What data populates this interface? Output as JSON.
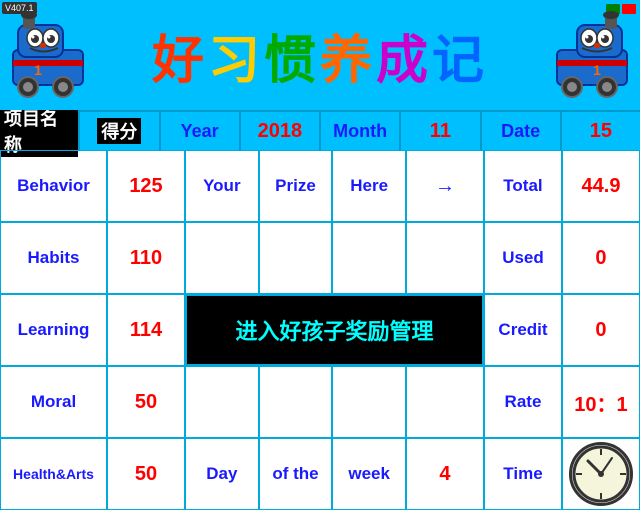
{
  "version": "V407.1",
  "flags": [
    "red",
    "green"
  ],
  "title": {
    "chars": [
      "好",
      "习",
      "惯",
      "养",
      "成",
      "记"
    ],
    "colors": [
      "#ff3300",
      "#ffcc00",
      "#009900",
      "#ff6600",
      "#cc00cc",
      "#0066ff"
    ]
  },
  "date_bar": {
    "year_label": "Year",
    "year_value": "2018",
    "month_label": "Month",
    "month_value": "11",
    "date_label": "Date",
    "date_value": "15"
  },
  "rows": [
    {
      "label": "Behavior",
      "score": "125",
      "col3": "Your",
      "col4": "Prize",
      "col5": "Here",
      "col6": "→",
      "right_label": "Total",
      "right_value": "44.9"
    },
    {
      "label": "Habits",
      "score": "110",
      "col3": "",
      "col4": "",
      "col5": "",
      "col6": "",
      "right_label": "Used",
      "right_value": "0"
    },
    {
      "label": "Learning",
      "score": "114",
      "col3": "进入好孩子奖励管理",
      "col4": "",
      "col5": "",
      "col6": "",
      "right_label": "Credit",
      "right_value": "0",
      "popup": true
    },
    {
      "label": "Moral",
      "score": "50",
      "col3": "",
      "col4": "",
      "col5": "",
      "col6": "",
      "right_label": "Rate",
      "right_value": "10：1"
    },
    {
      "label": "Health&Arts",
      "score": "50",
      "col3": "Day",
      "col4": "of the",
      "col5": "week",
      "col6": "4",
      "right_label": "Time",
      "right_value": "clock"
    }
  ],
  "header_labels": {
    "col1": "项目名称",
    "col2": "得分"
  }
}
